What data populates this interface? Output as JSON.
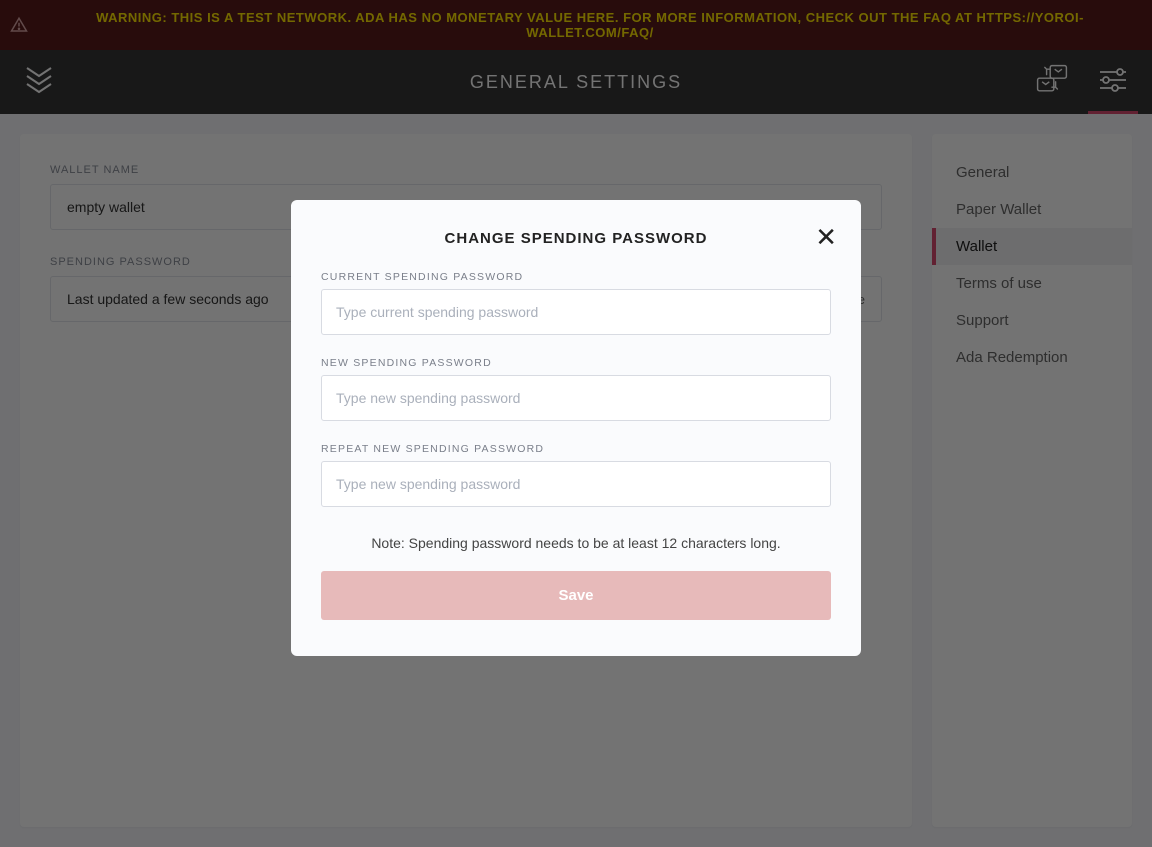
{
  "warning": {
    "text": "WARNING: THIS IS A TEST NETWORK. ADA HAS NO MONETARY VALUE HERE. FOR MORE INFORMATION, CHECK OUT THE FAQ AT HTTPS://YOROI-WALLET.COM/FAQ/"
  },
  "header": {
    "title": "GENERAL SETTINGS"
  },
  "content": {
    "wallet_name_label": "WALLET NAME",
    "wallet_name_value": "empty wallet",
    "spending_password_label": "SPENDING PASSWORD",
    "spending_password_value": "Last updated a few seconds ago",
    "change_link": "change"
  },
  "sidebar": {
    "items": [
      {
        "label": "General",
        "active": false
      },
      {
        "label": "Paper Wallet",
        "active": false
      },
      {
        "label": "Wallet",
        "active": true
      },
      {
        "label": "Terms of use",
        "active": false
      },
      {
        "label": "Support",
        "active": false
      },
      {
        "label": "Ada Redemption",
        "active": false
      }
    ]
  },
  "modal": {
    "title": "CHANGE SPENDING PASSWORD",
    "current_label": "CURRENT SPENDING PASSWORD",
    "current_placeholder": "Type current spending password",
    "new_label": "NEW SPENDING PASSWORD",
    "new_placeholder": "Type new spending password",
    "repeat_label": "REPEAT NEW SPENDING PASSWORD",
    "repeat_placeholder": "Type new spending password",
    "note": "Note: Spending password needs to be at least 12 characters long.",
    "save_label": "Save"
  }
}
